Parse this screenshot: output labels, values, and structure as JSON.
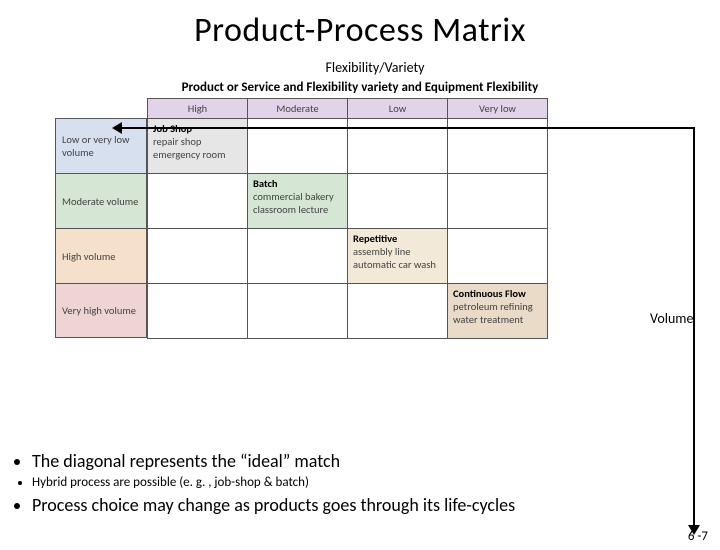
{
  "title": "Product-Process Matrix",
  "axis_x_label": "Flexibility/Variety",
  "axis_y_label": "Volume",
  "matrix_heading": "Product or Service and Flexibility variety and Equipment Flexibility",
  "col_headers": [
    "High",
    "Moderate",
    "Low",
    "Very low"
  ],
  "row_headers": [
    "Low or very low volume",
    "Moderate volume",
    "High volume",
    "Very high volume"
  ],
  "cells": {
    "c11_title": "Job Shop",
    "c11_lines": "repair shop\nemergency room",
    "c22_title": "Batch",
    "c22_lines": "commercial bakery\nclassroom lecture",
    "c33_title": "Repetitive",
    "c33_lines": "assembly line\nautomatic car wash",
    "c44_title": "Continuous Flow",
    "c44_lines": "petroleum refining\nwater treatment"
  },
  "bullets": {
    "b1": "The diagonal represents the “ideal” match",
    "b2": "Hybrid process are possible (e. g. , job-shop & batch)",
    "b3": "Process choice may change as products goes through its life-cycles"
  },
  "page_number": "6 -7",
  "chart_data": {
    "type": "table",
    "title": "Product-Process Matrix",
    "x_dimension": "Flexibility/Variety",
    "y_dimension": "Volume",
    "columns": [
      "High",
      "Moderate",
      "Low",
      "Very low"
    ],
    "rows": [
      "Low or very low volume",
      "Moderate volume",
      "High volume",
      "Very high volume"
    ],
    "diagonal_entries": [
      {
        "row": 0,
        "col": 0,
        "process": "Job Shop",
        "examples": [
          "repair shop",
          "emergency room"
        ]
      },
      {
        "row": 1,
        "col": 1,
        "process": "Batch",
        "examples": [
          "commercial bakery",
          "classroom lecture"
        ]
      },
      {
        "row": 2,
        "col": 2,
        "process": "Repetitive",
        "examples": [
          "assembly line",
          "automatic car wash"
        ]
      },
      {
        "row": 3,
        "col": 3,
        "process": "Continuous Flow",
        "examples": [
          "petroleum refining",
          "water treatment"
        ]
      }
    ]
  }
}
